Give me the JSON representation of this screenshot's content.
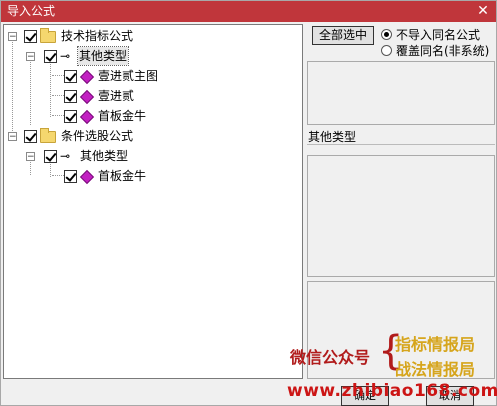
{
  "window": {
    "title": "导入公式",
    "close_glyph": "✕"
  },
  "tree": {
    "groups": [
      {
        "label": "技术指标公式",
        "sub_label": "其他类型",
        "items": [
          "壹进贰主图",
          "壹进贰",
          "首板金牛"
        ]
      },
      {
        "label": "条件选股公式",
        "sub_label": "其他类型",
        "items": [
          "首板金牛"
        ]
      }
    ]
  },
  "right": {
    "select_all": "全部选中",
    "options": [
      "不导入同名公式",
      "覆盖同名(非系统)"
    ],
    "selected_option": 0,
    "category_label": "其他类型"
  },
  "watermark": {
    "wechat": "微信公众号",
    "name1": "指标情报局",
    "name2": "战法情报局",
    "url": "www.zhibiao168.com"
  },
  "buttons": {
    "confirm": "确定",
    "cancel": "取消"
  },
  "icons": {
    "folder": "folder-icon",
    "key": "key-icon",
    "formula": "formula-gem-icon"
  }
}
